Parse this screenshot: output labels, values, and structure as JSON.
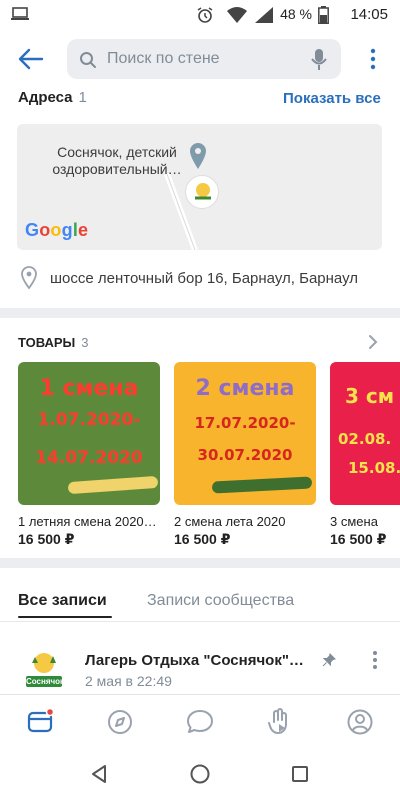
{
  "status_bar": {
    "battery_percent": "48 %",
    "time": "14:05"
  },
  "header": {
    "search_placeholder": "Поиск по стене"
  },
  "addresses": {
    "title": "Адреса",
    "count": "1",
    "show_all": "Показать все",
    "map_label": "Соснячок, детский оздоровительный…",
    "map_logo": "Google",
    "address": "шоссе ленточный бор 16, Барнаул, Барнаул"
  },
  "products": {
    "title": "ТОВАРЫ",
    "count": "3",
    "items": [
      {
        "image_lines": [
          "1 смена",
          "1.07.2020-",
          "14.07.2020"
        ],
        "name": "1 летняя смена 2020…",
        "price": "16 500 ₽",
        "bg": "#5d8a3a"
      },
      {
        "image_lines": [
          "2 смена",
          "17.07.2020-",
          "30.07.2020"
        ],
        "name": "2 смена лета 2020",
        "price": "16 500 ₽",
        "bg": "#f7b42c"
      },
      {
        "image_lines": [
          "3 см",
          "02.08.",
          "15.08."
        ],
        "name": "3 смена",
        "price": "16 500 ₽",
        "bg": "#e8204a"
      }
    ]
  },
  "tabs": {
    "all_posts": "Все записи",
    "community_posts": "Записи сообщества"
  },
  "post": {
    "author": "Лагерь Отдыха \"Соснячок\"…",
    "date": "2 мая в 22:49",
    "avatar_text": "Соснячок"
  },
  "colors": {
    "accent": "#2a6fbd",
    "divider": "#ebedf0",
    "muted": "#818c99",
    "notification": "#e64646"
  }
}
